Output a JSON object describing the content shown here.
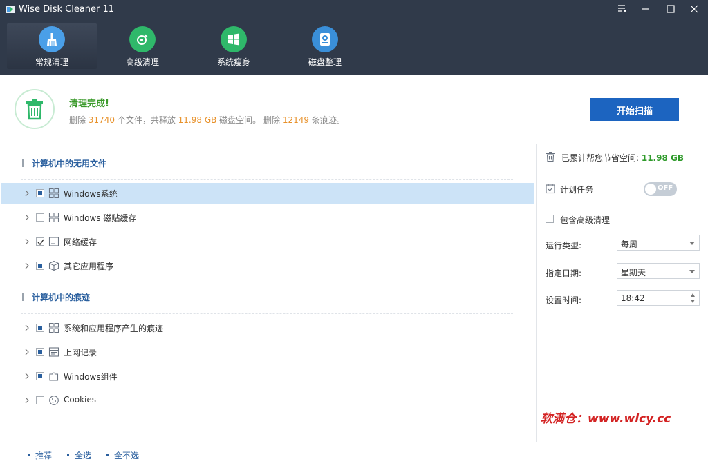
{
  "app": {
    "title": "Wise Disk Cleaner 11"
  },
  "nav": {
    "tabs": [
      {
        "label": "常规清理",
        "icon": "broom-icon",
        "color": "#4a9fe8"
      },
      {
        "label": "高级清理",
        "icon": "magnifier-disc-icon",
        "color": "#2fb86a"
      },
      {
        "label": "系统瘦身",
        "icon": "windows-logo-icon",
        "color": "#2fb86a"
      },
      {
        "label": "磁盘整理",
        "icon": "hard-drive-icon",
        "color": "#3a8fd9"
      }
    ]
  },
  "status": {
    "title": "清理完成!",
    "line": {
      "p1": "删除 ",
      "files": "31740",
      "p2": " 个文件，共释放 ",
      "size": "11.98 GB",
      "p3": " 磁盘空间。 删除 ",
      "traces": "12149",
      "p4": " 条痕迹。"
    },
    "scan_button": "开始扫描"
  },
  "sections": [
    {
      "title": "计算机中的无用文件",
      "items": [
        {
          "label": "Windows系统",
          "state": "partial",
          "icon": "windows-tiles-icon"
        },
        {
          "label": "Windows 磁贴缓存",
          "state": "unchecked",
          "icon": "windows-tiles-icon"
        },
        {
          "label": "网络缓存",
          "state": "checked",
          "icon": "browser-window-icon"
        },
        {
          "label": "其它应用程序",
          "state": "partial",
          "icon": "package-box-icon"
        }
      ]
    },
    {
      "title": "计算机中的痕迹",
      "items": [
        {
          "label": "系统和应用程序产生的痕迹",
          "state": "partial",
          "icon": "windows-tiles-icon"
        },
        {
          "label": "上网记录",
          "state": "partial",
          "icon": "browser-window-icon"
        },
        {
          "label": "Windows组件",
          "state": "partial",
          "icon": "puzzle-icon"
        },
        {
          "label": "Cookies",
          "state": "unchecked",
          "icon": "cookie-icon"
        }
      ]
    }
  ],
  "right": {
    "saved_label": "已累计帮您节省空间: ",
    "saved_value": "11.98 GB",
    "schedule_label": "计划任务",
    "toggle_text": "OFF",
    "include_advanced": "包含高级清理",
    "run_type_label": "运行类型:",
    "run_type_value": "每周",
    "date_label": "指定日期:",
    "date_value": "星期天",
    "time_label": "设置时间:",
    "time_value": "18:42"
  },
  "footer": {
    "recommend": "推荐",
    "select_all": "全选",
    "select_none": "全不选"
  },
  "watermark": "软满仓：www.wlcy.cc"
}
